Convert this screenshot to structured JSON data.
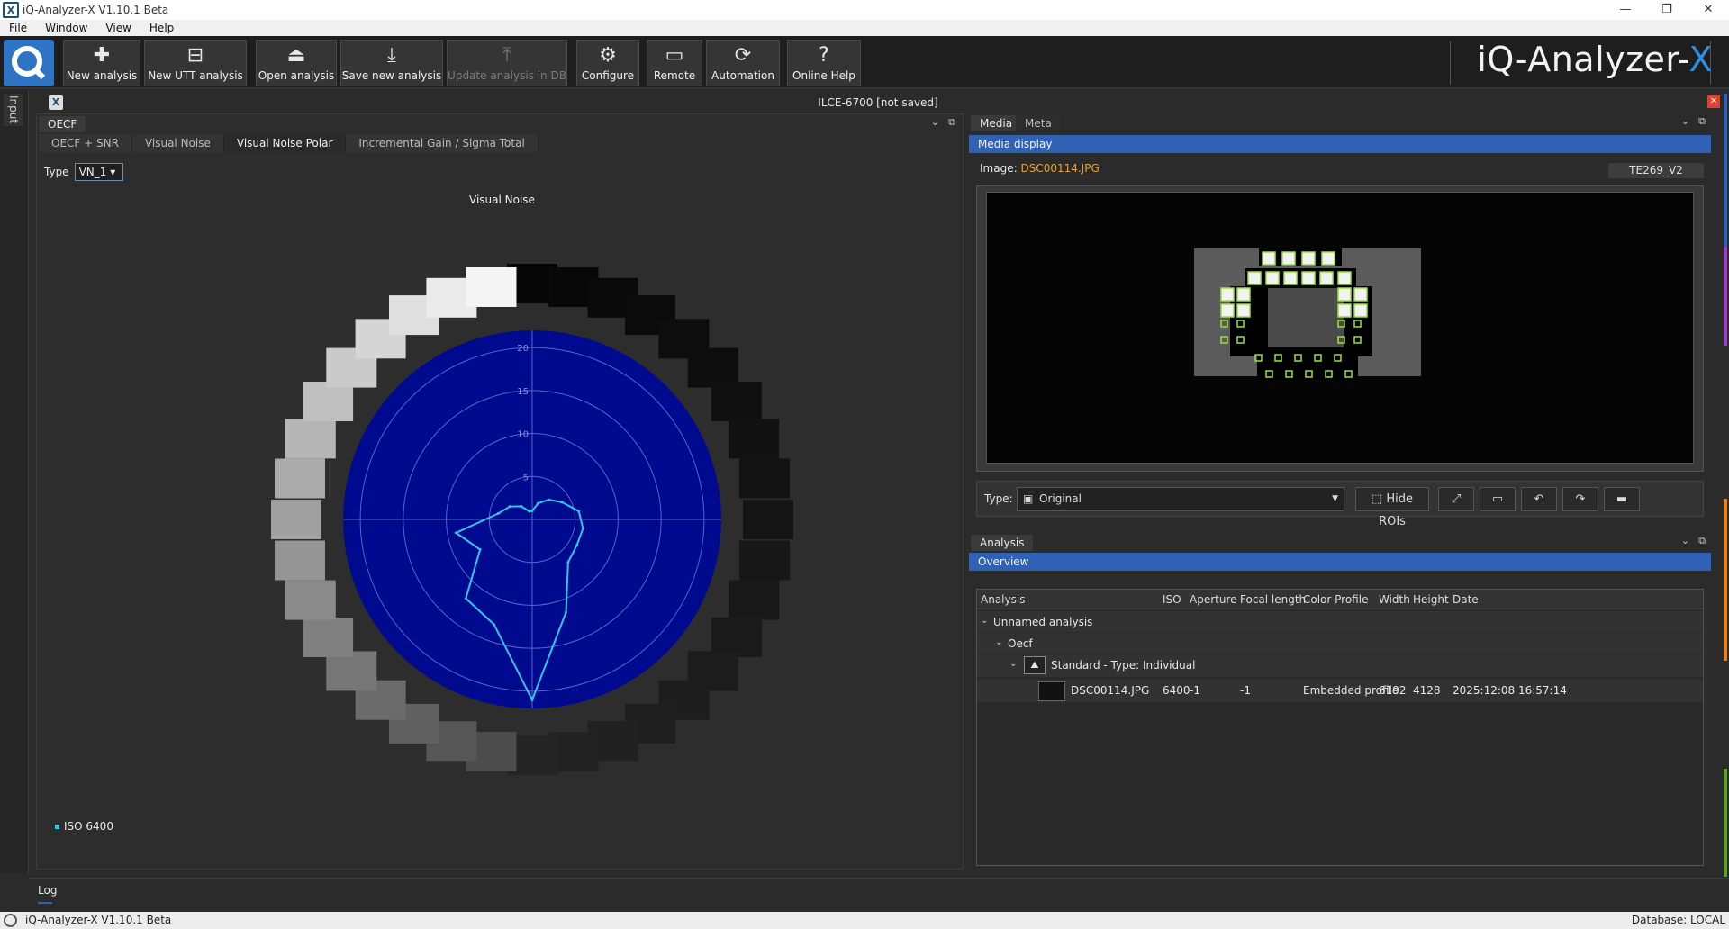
{
  "window": {
    "title": "iQ-Analyzer-X V1.10.1 Beta",
    "min": "—",
    "max": "❐",
    "close": "✕"
  },
  "menu": [
    "File",
    "Window",
    "View",
    "Help"
  ],
  "toolbar": {
    "buttons": [
      {
        "label": "New analysis",
        "icon": "plus-icon"
      },
      {
        "label": "New UTT analysis",
        "icon": "utt-icon"
      },
      {
        "label": "Open analysis",
        "icon": "open-icon"
      },
      {
        "label": "Save new analysis",
        "icon": "save-icon"
      },
      {
        "label": "Update analysis in DB",
        "icon": "update-db-icon",
        "disabled": true
      },
      {
        "label": "Configure",
        "icon": "gear-icon"
      },
      {
        "label": "Remote",
        "icon": "monitor-icon"
      },
      {
        "label": "Automation",
        "icon": "automation-icon"
      },
      {
        "label": "Online Help",
        "icon": "help-icon"
      }
    ],
    "brand": "iQ-Analyzer-",
    "brand_x": "X"
  },
  "left_strip": {
    "input_tab": "Input"
  },
  "document": {
    "title": "ILCE-6700  [not saved]"
  },
  "left_panel": {
    "tab": "OECF",
    "subtabs": [
      "OECF + SNR",
      "Visual Noise",
      "Visual Noise Polar",
      "Incremental Gain / Sigma Total"
    ],
    "active_subtab": 2,
    "type_label": "Type",
    "type_value": "VN_1"
  },
  "chart_data": {
    "type": "polar",
    "title": "Visual Noise",
    "radial_ticks": [
      "5",
      "10",
      "15",
      "20"
    ],
    "rmax": 22,
    "series": [
      {
        "name": "ISO 6400",
        "color": "#33c6e8",
        "points": [
          {
            "theta": 0,
            "r": 1.0
          },
          {
            "theta": 20,
            "r": 2.0
          },
          {
            "theta": 40,
            "r": 3.0
          },
          {
            "theta": 60,
            "r": 4.0
          },
          {
            "theta": 80,
            "r": 5.5
          },
          {
            "theta": 100,
            "r": 6.0
          },
          {
            "theta": 120,
            "r": 6.0
          },
          {
            "theta": 140,
            "r": 6.5
          },
          {
            "theta": 160,
            "r": 11.5
          },
          {
            "theta": 180,
            "r": 21.0
          },
          {
            "theta": 200,
            "r": 13.0
          },
          {
            "theta": 220,
            "r": 12.0
          },
          {
            "theta": 240,
            "r": 7.0
          },
          {
            "theta": 260,
            "r": 9.0
          },
          {
            "theta": 280,
            "r": 4.0
          },
          {
            "theta": 300,
            "r": 3.0
          },
          {
            "theta": 320,
            "r": 2.0
          },
          {
            "theta": 340,
            "r": 1.0
          }
        ]
      }
    ]
  },
  "right_panel": {
    "tabs": [
      "Media",
      "Meta"
    ],
    "media_header": "Media display",
    "image_label": "Image:",
    "image_file": "DSC00114.JPG",
    "chart_tag": "TE269_V2",
    "type_label": "Type:",
    "type_value": "Original",
    "hide_rois": "Hide ROIs",
    "analysis_tab": "Analysis",
    "overview_header": "Overview",
    "table": {
      "columns": [
        "Analysis",
        "ISO",
        "Aperture",
        "Focal length",
        "Color Profile",
        "Width",
        "Height",
        "Date"
      ],
      "tree": [
        {
          "level": 0,
          "label": "Unnamed analysis"
        },
        {
          "level": 1,
          "label": "Oecf"
        },
        {
          "level": 2,
          "label": "Standard - Type: Individual"
        }
      ],
      "row": {
        "file": "DSC00114.JPG",
        "iso": "6400",
        "aperture": "-1",
        "focal": "-1",
        "profile": "Embedded profile",
        "width": "6192",
        "height": "4128",
        "date": "2025:12:08 16:57:14"
      }
    }
  },
  "log": {
    "label": "Log"
  },
  "status": {
    "left": "iQ-Analyzer-X V1.10.1 Beta",
    "right": "Database: LOCAL"
  }
}
